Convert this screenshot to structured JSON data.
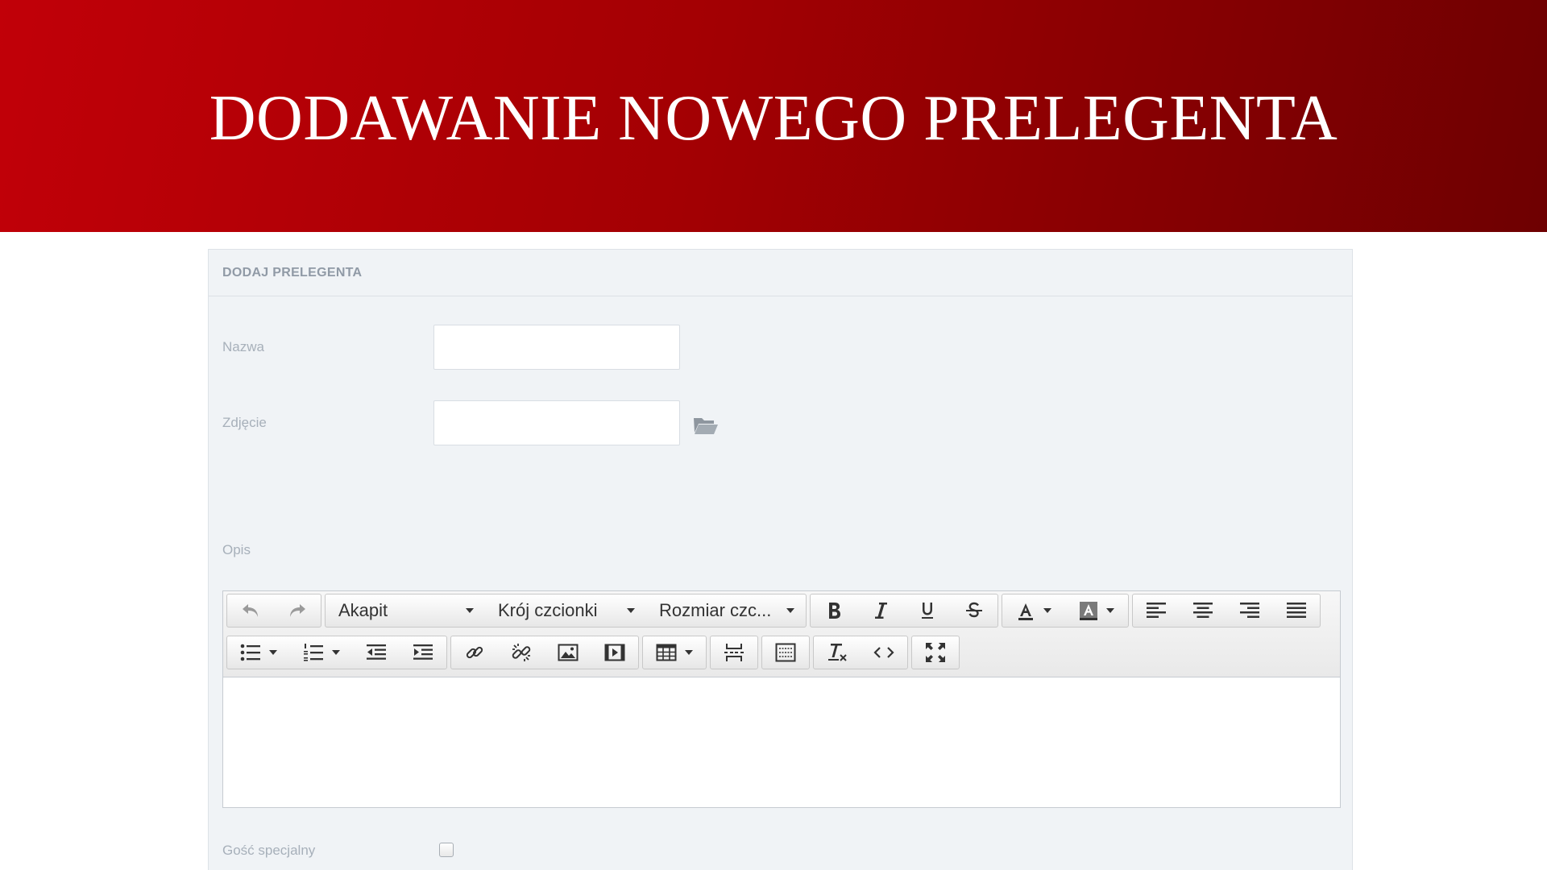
{
  "banner": {
    "title": "DODAWANIE NOWEGO PRELEGENTA"
  },
  "panel": {
    "title": "DODAJ PRELEGENTA"
  },
  "form": {
    "name": {
      "label": "Nazwa",
      "value": ""
    },
    "photo": {
      "label": "Zdjęcie",
      "value": ""
    },
    "description": {
      "label": "Opis"
    },
    "special_guest": {
      "label": "Gość specjalny",
      "checked": false
    }
  },
  "editor": {
    "paragraph": "Akapit",
    "font_family": "Krój czcionki",
    "font_size": "Rozmiar czc..."
  },
  "colors": {
    "banner_start": "#c10008",
    "banner_end": "#6e0001",
    "panel_bg": "#f0f3f6",
    "label": "#a7b0ba"
  }
}
